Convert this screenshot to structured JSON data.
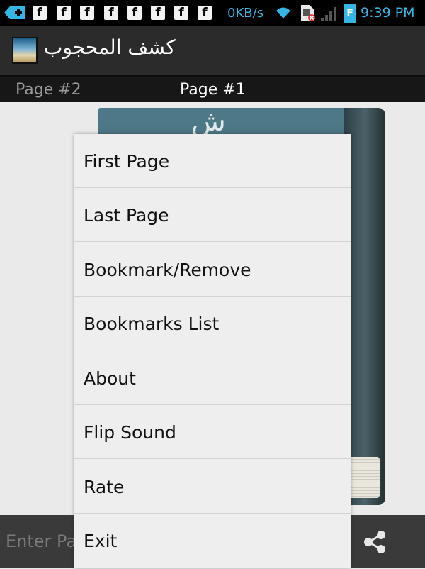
{
  "status_bar": {
    "notification_icons": [
      "plus-icon",
      "facebook-icon",
      "facebook-icon",
      "facebook-icon",
      "facebook-icon",
      "facebook-icon",
      "facebook-icon",
      "facebook-icon",
      "facebook-icon"
    ],
    "network_speed": "0KB/s",
    "battery_letter": "F",
    "time": "9:39 PM"
  },
  "action_bar": {
    "title": "كشف المحجوب",
    "icon": "app-book-icon"
  },
  "tabs": [
    {
      "label": "Page #2"
    },
    {
      "label": "Page #1"
    }
  ],
  "content": {
    "book_letter": "ش"
  },
  "bottom_bar": {
    "page_input_placeholder": "Enter Page",
    "share_icon": "share-icon"
  },
  "menu": {
    "items": [
      {
        "label": "First Page"
      },
      {
        "label": "Last Page"
      },
      {
        "label": "Bookmark/Remove"
      },
      {
        "label": "Bookmarks List"
      },
      {
        "label": "About"
      },
      {
        "label": "Flip Sound"
      },
      {
        "label": "Rate"
      },
      {
        "label": "Exit"
      }
    ]
  },
  "colors": {
    "status_accent": "#33b5e5",
    "action_bar_bg": "#2b2b2b",
    "menu_bg": "#eeeeee"
  }
}
